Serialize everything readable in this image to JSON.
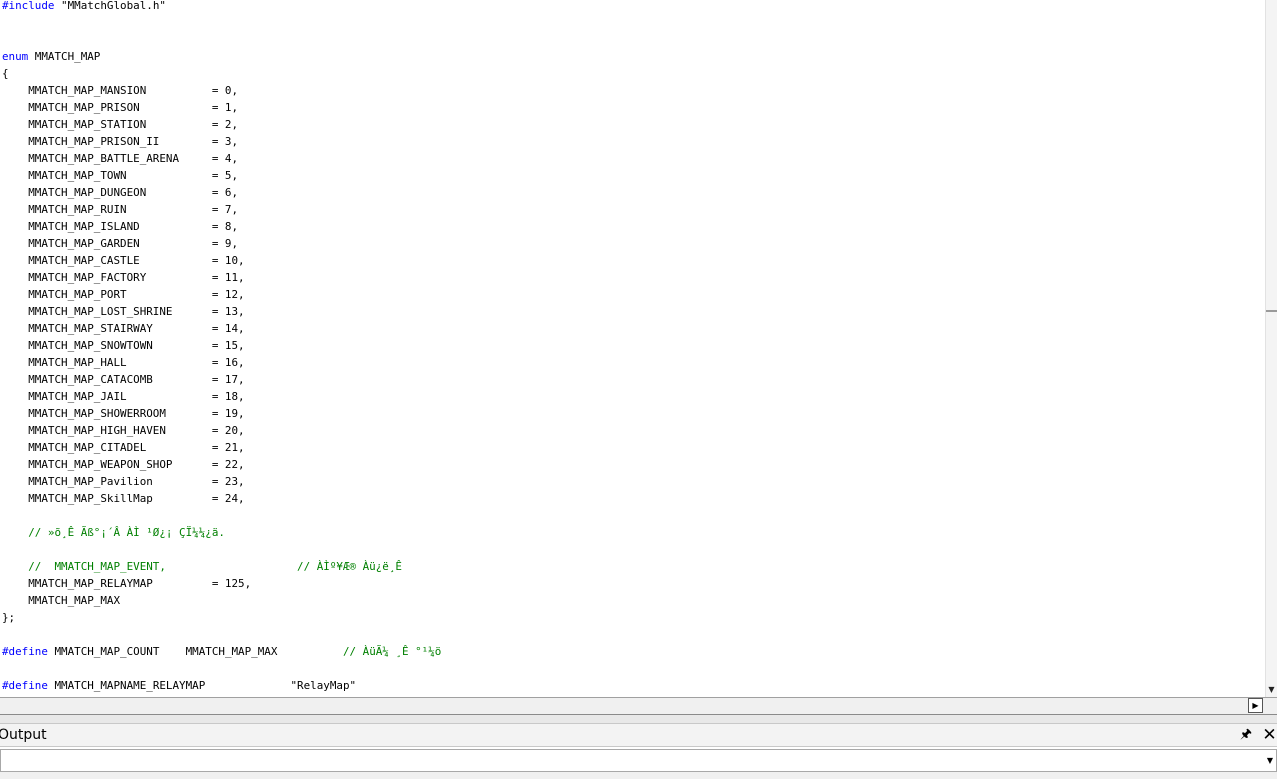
{
  "editor": {
    "lines": [
      {
        "segments": [
          {
            "t": "#include",
            "c": "kw"
          },
          {
            "t": " \"MMatchGlobal.h\"",
            "c": ""
          }
        ]
      },
      {
        "segments": []
      },
      {
        "segments": []
      },
      {
        "segments": [
          {
            "t": "enum",
            "c": "kw"
          },
          {
            "t": " MMATCH_MAP",
            "c": ""
          }
        ]
      },
      {
        "segments": [
          {
            "t": "{",
            "c": ""
          }
        ]
      },
      {
        "segments": [
          {
            "t": "    MMATCH_MAP_MANSION          = 0,",
            "c": ""
          }
        ]
      },
      {
        "segments": [
          {
            "t": "    MMATCH_MAP_PRISON           = 1,",
            "c": ""
          }
        ]
      },
      {
        "segments": [
          {
            "t": "    MMATCH_MAP_STATION          = 2,",
            "c": ""
          }
        ]
      },
      {
        "segments": [
          {
            "t": "    MMATCH_MAP_PRISON_II        = 3,",
            "c": ""
          }
        ]
      },
      {
        "segments": [
          {
            "t": "    MMATCH_MAP_BATTLE_ARENA     = 4,",
            "c": ""
          }
        ]
      },
      {
        "segments": [
          {
            "t": "    MMATCH_MAP_TOWN             = 5,",
            "c": ""
          }
        ]
      },
      {
        "segments": [
          {
            "t": "    MMATCH_MAP_DUNGEON          = 6,",
            "c": ""
          }
        ]
      },
      {
        "segments": [
          {
            "t": "    MMATCH_MAP_RUIN             = 7,",
            "c": ""
          }
        ]
      },
      {
        "segments": [
          {
            "t": "    MMATCH_MAP_ISLAND           = 8,",
            "c": ""
          }
        ]
      },
      {
        "segments": [
          {
            "t": "    MMATCH_MAP_GARDEN           = 9,",
            "c": ""
          }
        ]
      },
      {
        "segments": [
          {
            "t": "    MMATCH_MAP_CASTLE           = 10,",
            "c": ""
          }
        ]
      },
      {
        "segments": [
          {
            "t": "    MMATCH_MAP_FACTORY          = 11,",
            "c": ""
          }
        ]
      },
      {
        "segments": [
          {
            "t": "    MMATCH_MAP_PORT             = 12,",
            "c": ""
          }
        ]
      },
      {
        "segments": [
          {
            "t": "    MMATCH_MAP_LOST_SHRINE      = 13,",
            "c": ""
          }
        ]
      },
      {
        "segments": [
          {
            "t": "    MMATCH_MAP_STAIRWAY         = 14,",
            "c": ""
          }
        ]
      },
      {
        "segments": [
          {
            "t": "    MMATCH_MAP_SNOWTOWN         = 15,",
            "c": ""
          }
        ]
      },
      {
        "segments": [
          {
            "t": "    MMATCH_MAP_HALL             = 16,",
            "c": ""
          }
        ]
      },
      {
        "segments": [
          {
            "t": "    MMATCH_MAP_CATACOMB         = 17,",
            "c": ""
          }
        ]
      },
      {
        "segments": [
          {
            "t": "    MMATCH_MAP_JAIL             = 18,",
            "c": ""
          }
        ]
      },
      {
        "segments": [
          {
            "t": "    MMATCH_MAP_SHOWERROOM       = 19,",
            "c": ""
          }
        ]
      },
      {
        "segments": [
          {
            "t": "    MMATCH_MAP_HIGH_HAVEN       = 20,",
            "c": ""
          }
        ]
      },
      {
        "segments": [
          {
            "t": "    MMATCH_MAP_CITADEL          = 21,",
            "c": ""
          }
        ]
      },
      {
        "segments": [
          {
            "t": "    MMATCH_MAP_WEAPON_SHOP      = 22,",
            "c": ""
          }
        ]
      },
      {
        "segments": [
          {
            "t": "    MMATCH_MAP_Pavilion         = 23,",
            "c": ""
          }
        ]
      },
      {
        "segments": [
          {
            "t": "    MMATCH_MAP_SkillMap         = 24,",
            "c": ""
          }
        ]
      },
      {
        "segments": []
      },
      {
        "segments": [
          {
            "t": "    ",
            "c": ""
          },
          {
            "t": "// »õ¸Ê Ãß°¡´Â ÀÌ ¹Ø¿¡ ÇÏ¼¼¿ä.",
            "c": "cm"
          }
        ]
      },
      {
        "segments": []
      },
      {
        "segments": [
          {
            "t": "    ",
            "c": ""
          },
          {
            "t": "//  MMATCH_MAP_EVENT,                    // ÀÌº¥Æ® Àü¿ë¸Ê",
            "c": "cm"
          }
        ]
      },
      {
        "segments": [
          {
            "t": "    MMATCH_MAP_RELAYMAP         = 125,",
            "c": ""
          }
        ]
      },
      {
        "segments": [
          {
            "t": "    MMATCH_MAP_MAX",
            "c": ""
          }
        ]
      },
      {
        "segments": [
          {
            "t": "};",
            "c": ""
          }
        ]
      },
      {
        "segments": []
      },
      {
        "segments": [
          {
            "t": "#define",
            "c": "kw"
          },
          {
            "t": " MMATCH_MAP_COUNT    MMATCH_MAP_MAX          ",
            "c": ""
          },
          {
            "t": "// ÀüÃ¼ ¸Ê °¹¼ö",
            "c": "cm"
          }
        ]
      },
      {
        "segments": []
      },
      {
        "segments": [
          {
            "t": "#define",
            "c": "kw"
          },
          {
            "t": " MMATCH_MAPNAME_RELAYMAP             \"RelayMap\"",
            "c": ""
          }
        ]
      }
    ]
  },
  "output_panel": {
    "title": "Output",
    "pin_icon": "pin-icon",
    "close_icon": "close-icon"
  },
  "colors": {
    "keyword": "#0000ff",
    "comment": "#008000",
    "text": "#000000"
  }
}
